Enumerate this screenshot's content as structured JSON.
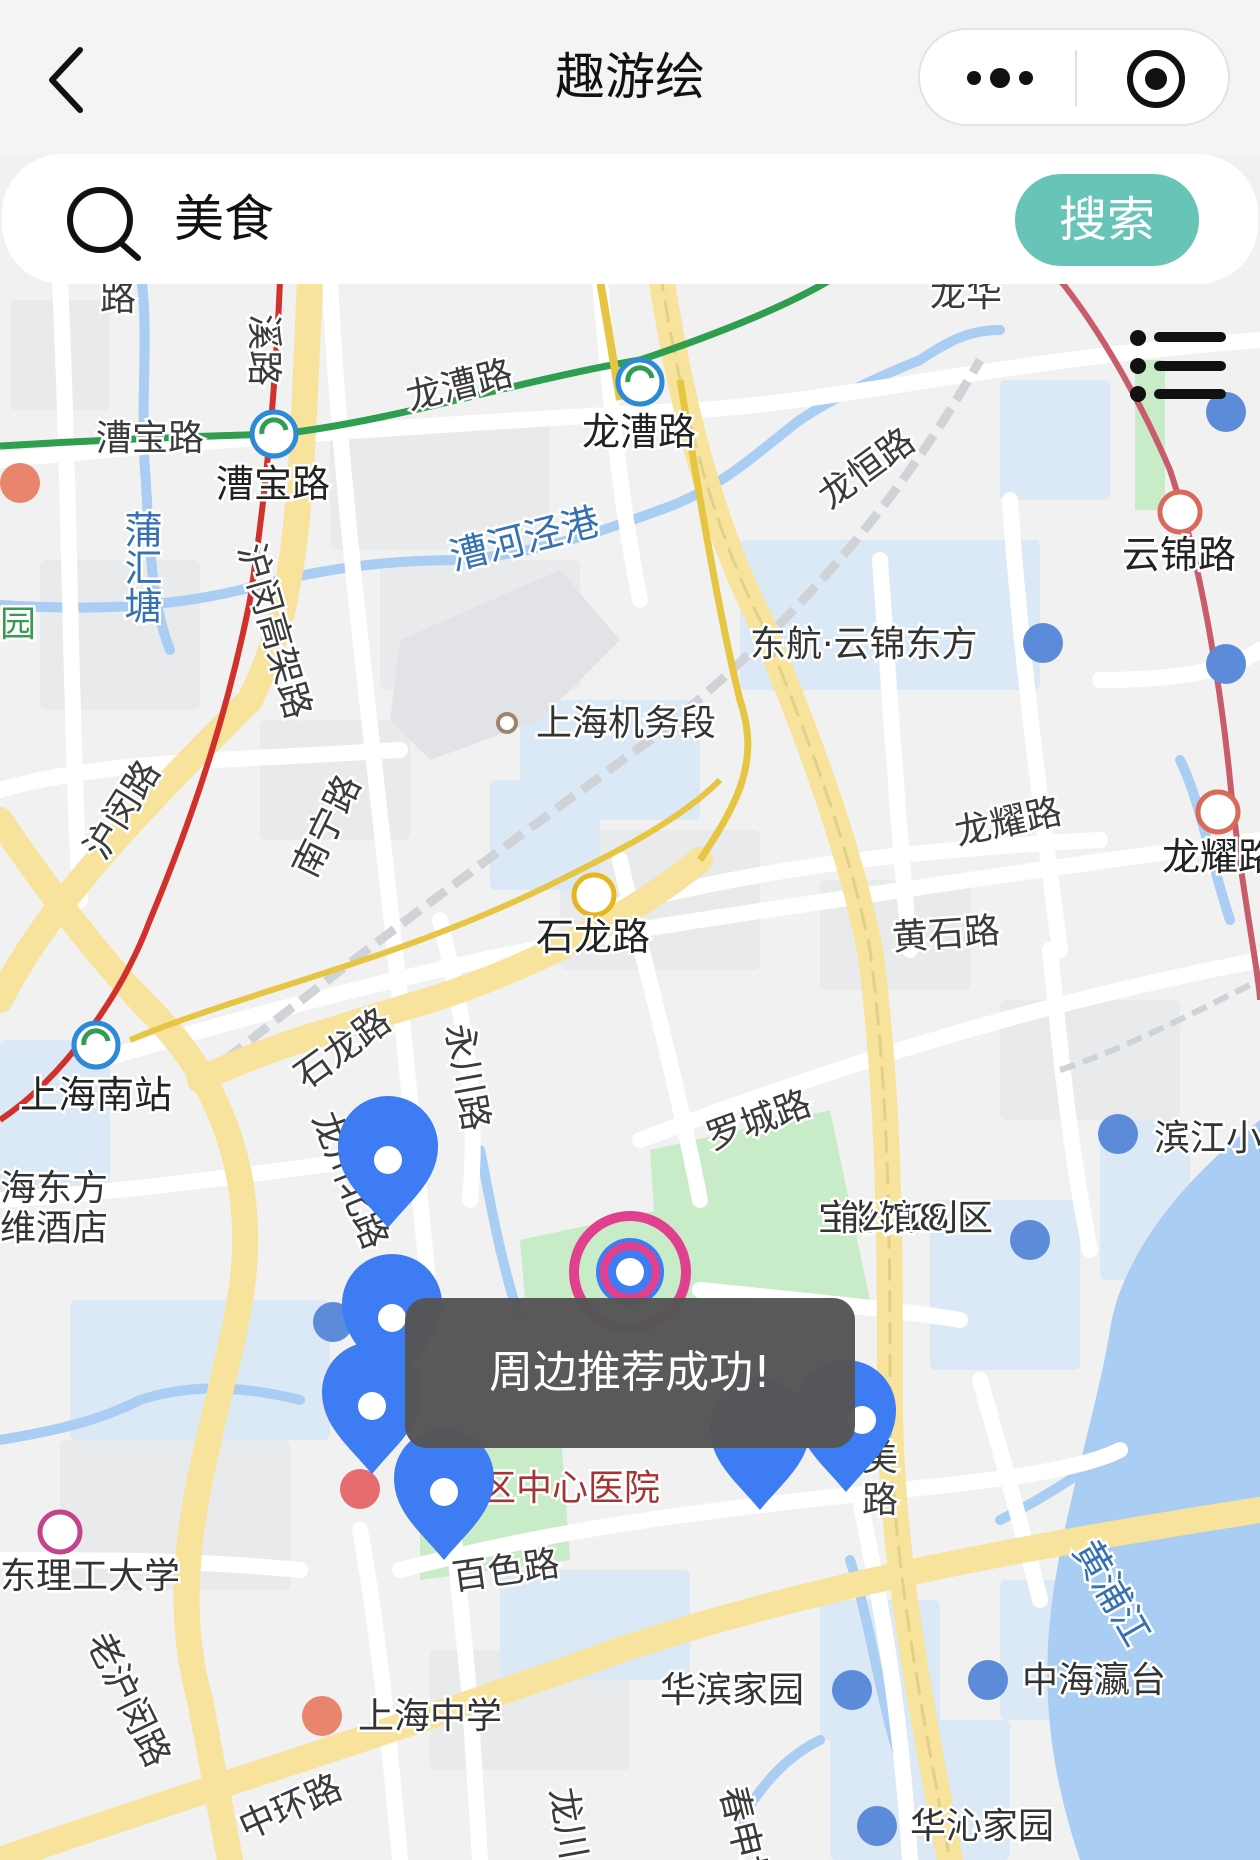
{
  "app": {
    "title": "趣游绘"
  },
  "search": {
    "value": "美食",
    "button_label": "搜索"
  },
  "toast": {
    "message": "周边推荐成功!"
  },
  "map": {
    "roads": [
      "溪路",
      "龙漕路",
      "漕宝路",
      "沪闵高架路",
      "沪闵路",
      "南宁路",
      "龙恒路",
      "龙耀路",
      "黄石路",
      "石龙路",
      "永川路",
      "龙川北路",
      "罗城路",
      "百色路",
      "老沪闵路",
      "中环路",
      "龙华",
      "路",
      "龙川",
      "春申塘",
      "美",
      "路"
    ],
    "rivers": [
      "漕河泾港",
      "蒲汇塘",
      "黄浦江"
    ],
    "metro_stations": [
      "龙漕路",
      "漕宝路",
      "上海南站",
      "云锦路",
      "龙耀路",
      "石龙路"
    ],
    "pois": [
      "上海机务段",
      "东航·云锦东方",
      "宝能·公馆1288小区",
      "滨江小",
      "华滨家园",
      "中海瀛台",
      "华沁家园",
      "上海中学",
      "区中心医院",
      "东理工大学",
      "海东方",
      "维酒店",
      "园"
    ]
  },
  "colors": {
    "accent": "#69c4b8",
    "pin": "#3d7cf2",
    "current": "#e0418e"
  }
}
